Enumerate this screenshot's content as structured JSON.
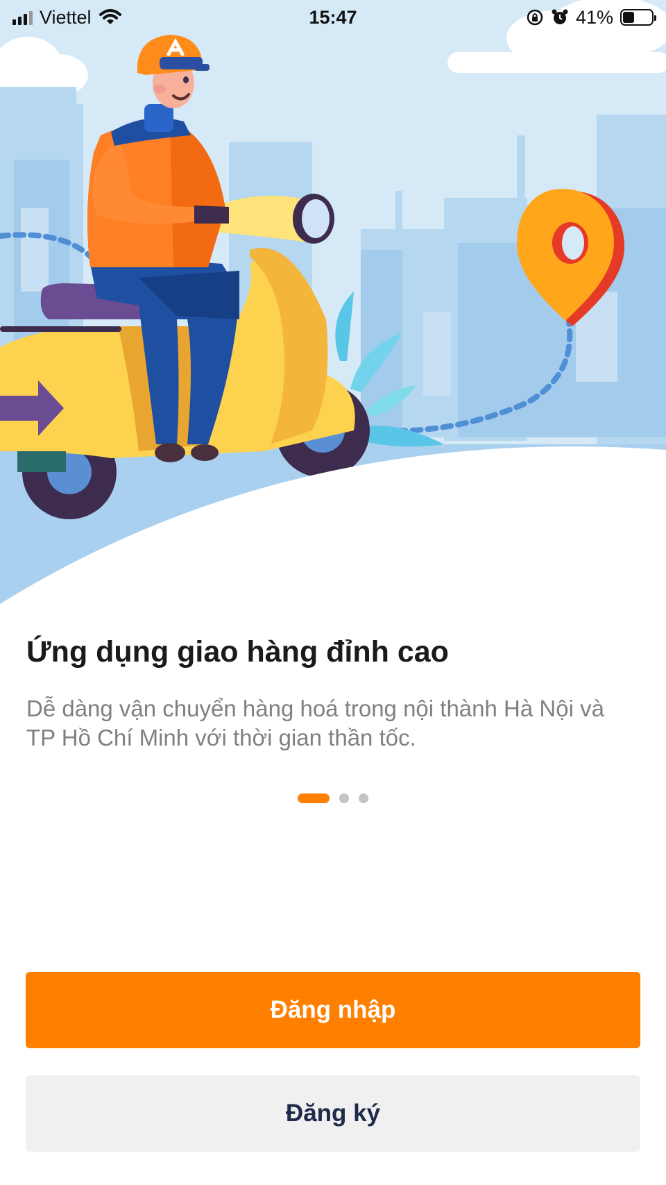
{
  "status_bar": {
    "carrier": "Viettel",
    "time": "15:47",
    "battery_percent": "41%",
    "battery_level": 0.41,
    "icons": [
      "signal-icon",
      "wifi-icon",
      "orientation-lock-icon",
      "alarm-icon",
      "battery-icon"
    ]
  },
  "onboarding": {
    "title": "Ứng dụng giao hàng đỉnh cao",
    "description": "Dễ dàng vận chuyển hàng hoá trong nội thành Hà Nội và TP Hồ Chí Minh với thời gian thần tốc.",
    "page_count": 3,
    "active_page": 1
  },
  "actions": {
    "login_label": "Đăng nhập",
    "register_label": "Đăng ký"
  },
  "colors": {
    "accent": "#FF8000",
    "sky": "#D6E9F7",
    "register_text": "#1D2A4A"
  }
}
